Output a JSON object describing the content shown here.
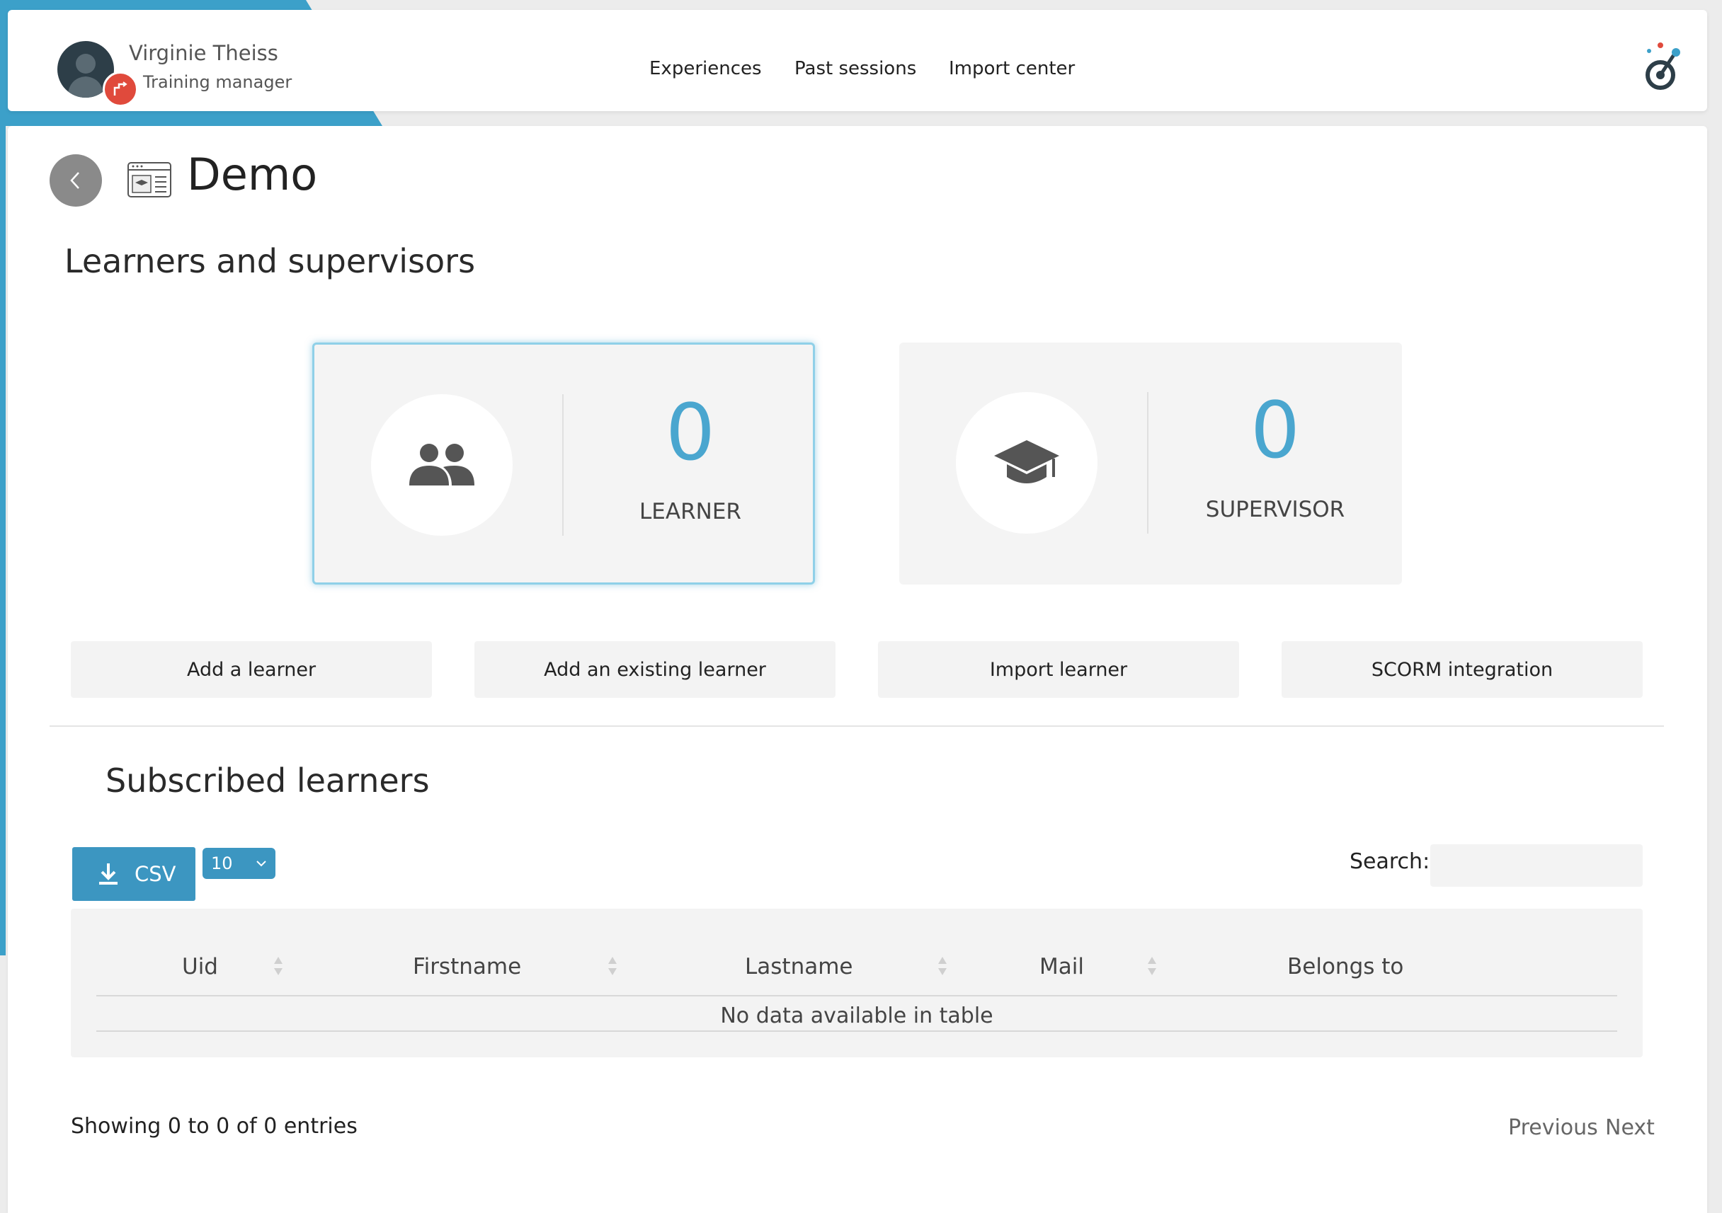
{
  "header": {
    "user_name": "Virginie Theiss",
    "user_role": "Training manager",
    "nav": [
      "Experiences",
      "Past sessions",
      "Import center"
    ]
  },
  "page": {
    "title": "Demo"
  },
  "learners_section": {
    "title": "Learners and supervisors",
    "stats": [
      {
        "value": "0",
        "label": "LEARNER",
        "icon": "users-icon"
      },
      {
        "value": "0",
        "label": "SUPERVISOR",
        "icon": "graduation-cap-icon"
      }
    ],
    "actions": [
      "Add a learner",
      "Add an existing learner",
      "Import learner",
      "SCORM integration"
    ]
  },
  "subscribed": {
    "title": "Subscribed learners",
    "csv_label": "CSV",
    "page_length": "10",
    "search_label": "Search:",
    "search_value": "",
    "columns": [
      "Uid",
      "Firstname",
      "Lastname",
      "Mail",
      "Belongs to"
    ],
    "empty_message": "No data available in table",
    "info": "Showing 0 to 0 of 0 entries",
    "previous_label": "Previous",
    "next_label": "Next"
  },
  "colors": {
    "accent": "#3c96c1",
    "value_blue": "#4aa6cf",
    "badge_red": "#e04a3c"
  }
}
